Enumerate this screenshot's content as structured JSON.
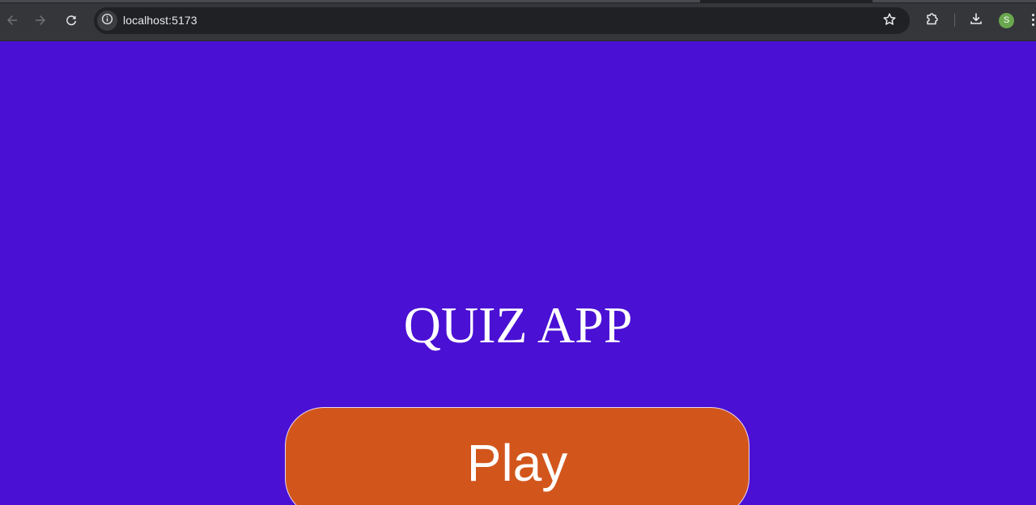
{
  "browser": {
    "url": "localhost:5173",
    "profile_initial": "S",
    "profile_color": "#6aa84f",
    "icons": {
      "back": "arrow-left-icon",
      "forward": "arrow-right-icon",
      "reload": "reload-icon",
      "site_info": "info-icon",
      "bookmark": "star-icon",
      "extensions": "puzzle-icon",
      "downloads": "download-icon",
      "menu": "more-vert-icon"
    }
  },
  "page": {
    "background_color": "#4a10d4",
    "title": "QUIZ APP",
    "play_label": "Play",
    "play_button_color": "#d2561c"
  }
}
